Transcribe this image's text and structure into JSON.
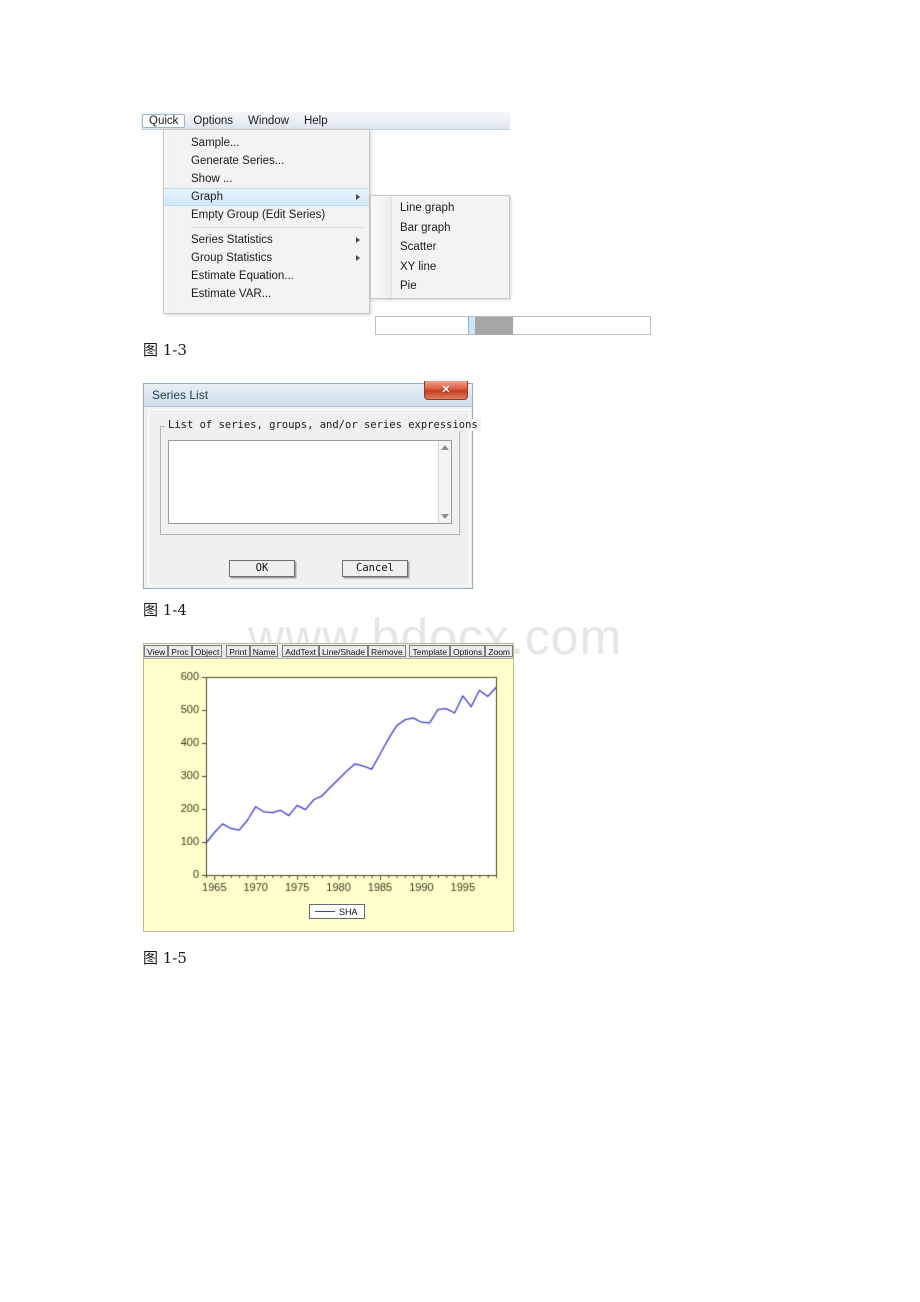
{
  "page": {
    "watermark": "www.bdocx.com",
    "captions": {
      "fig13": "图 1-3",
      "fig14": "图 1-4",
      "fig15": "图 1-5"
    }
  },
  "fig13": {
    "menubar": [
      {
        "label": "Quick",
        "selected": true
      },
      {
        "label": "Options",
        "selected": false
      },
      {
        "label": "Window",
        "selected": false
      },
      {
        "label": "Help",
        "selected": false
      }
    ],
    "dropdown_items": [
      {
        "label": "Sample...",
        "submenu": false,
        "highlighted": false
      },
      {
        "label": "Generate Series...",
        "submenu": false,
        "highlighted": false
      },
      {
        "label": "Show ...",
        "submenu": false,
        "highlighted": false
      },
      {
        "label": "Graph",
        "submenu": true,
        "highlighted": true
      },
      {
        "label": "Empty Group (Edit Series)",
        "submenu": false,
        "highlighted": false
      },
      {
        "label": "Series Statistics",
        "submenu": true,
        "highlighted": false
      },
      {
        "label": "Group Statistics",
        "submenu": true,
        "highlighted": false
      },
      {
        "label": "Estimate Equation...",
        "submenu": false,
        "highlighted": false
      },
      {
        "label": "Estimate VAR...",
        "submenu": false,
        "highlighted": false
      }
    ],
    "submenu_items": [
      {
        "label": "Line graph"
      },
      {
        "label": "Bar graph"
      },
      {
        "label": "Scatter"
      },
      {
        "label": "XY line"
      },
      {
        "label": "Pie"
      }
    ]
  },
  "fig14": {
    "title": "Series List",
    "close_label": "✕",
    "group_label": "List of series, groups, and/or series expressions",
    "textarea_value": "",
    "buttons": {
      "ok": "OK",
      "cancel": "Cancel"
    }
  },
  "fig15": {
    "toolbar": [
      "View",
      "Proc",
      "Object",
      "|",
      "Print",
      "Name",
      "|",
      "AddText",
      "Line/Shade",
      "Remove",
      "|",
      "Template",
      "Options",
      "Zoom"
    ],
    "colors": {
      "background": "#ffffcc",
      "series": "#3b3bd8",
      "axis": "#4a4a22",
      "plot_bg": "#ffffff"
    }
  },
  "chart_data": {
    "type": "line",
    "title": "",
    "xlabel": "",
    "ylabel": "",
    "xlim": [
      1964,
      1999
    ],
    "ylim": [
      0,
      600
    ],
    "yticks": [
      0,
      100,
      200,
      300,
      400,
      500,
      600
    ],
    "xticks": [
      1965,
      1970,
      1975,
      1980,
      1985,
      1990,
      1995
    ],
    "grid": false,
    "legend": [
      "SHA"
    ],
    "legend_position": "bottom-center",
    "series": [
      {
        "name": "SHA",
        "color": "#3b3bd8",
        "x": [
          1964,
          1965,
          1966,
          1967,
          1968,
          1969,
          1970,
          1971,
          1972,
          1973,
          1974,
          1975,
          1976,
          1977,
          1978,
          1979,
          1980,
          1981,
          1982,
          1983,
          1984,
          1985,
          1986,
          1987,
          1988,
          1989,
          1990,
          1991,
          1992,
          1993,
          1994,
          1995,
          1996,
          1997,
          1998,
          1999
        ],
        "values": [
          97,
          128,
          155,
          141,
          136,
          166,
          207,
          191,
          189,
          196,
          180,
          211,
          198,
          228,
          240,
          266,
          290,
          315,
          337,
          330,
          321,
          366,
          412,
          452,
          470,
          476,
          463,
          461,
          502,
          504,
          491,
          543,
          510,
          560,
          541,
          568
        ]
      }
    ]
  }
}
